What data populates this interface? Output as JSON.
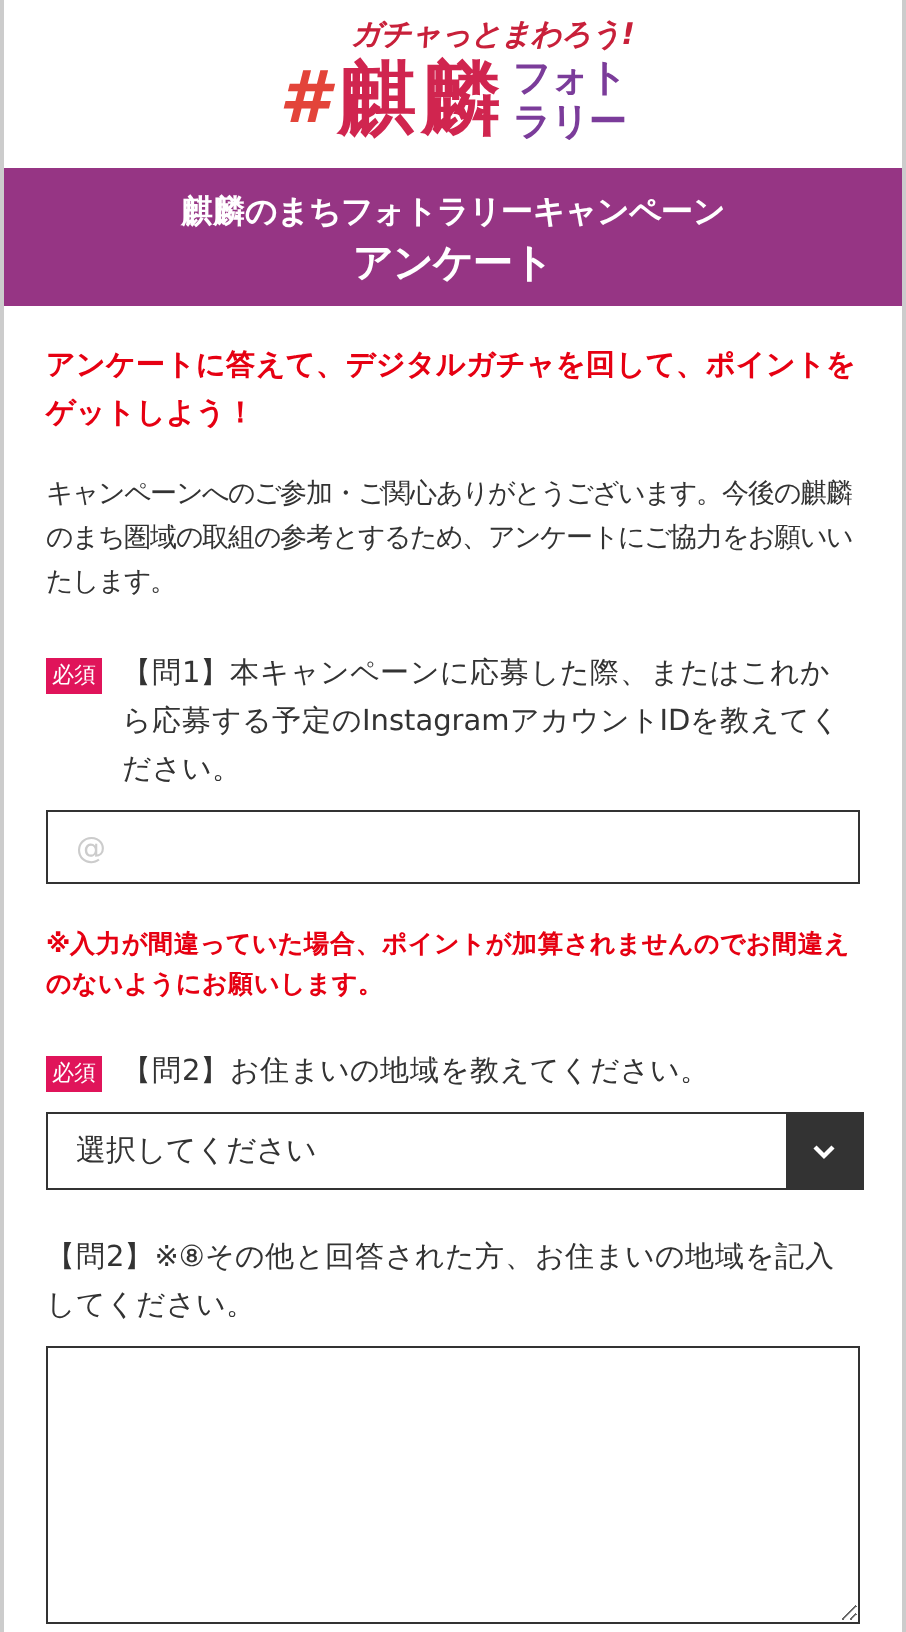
{
  "logo": {
    "tagline": "ガチャっとまわろう!",
    "hashtag": "#",
    "name": "麒麟",
    "photo": "フォト",
    "rally": "ラリー"
  },
  "header": {
    "line1": "麒麟のまちフォトラリーキャンペーン",
    "line2": "アンケート"
  },
  "lead": "アンケートに答えて、デジタルガチャを回して、ポイントをゲットしよう！",
  "intro": "キャンペーンへのご参加・ご関心ありがとうございます。今後の麒麟のまち圏域の取組の参考とするため、アンケートにご協力をお願いいたします。",
  "questions": [
    {
      "kind": "text",
      "required": true,
      "badge": "必須",
      "label": "【問1】本キャンペーンに応募した際、またはこれから応募する予定のInstagramアカウントIDを教えてください。",
      "placeholder": "@",
      "note": "※入力が間違っていた場合、ポイントが加算されませんのでお間違えのないようにお願いします。"
    },
    {
      "kind": "select",
      "required": true,
      "badge": "必須",
      "label": "【問2】お住まいの地域を教えてください。",
      "value": "選択してください"
    },
    {
      "kind": "textarea",
      "required": false,
      "label": "【問2】※⑧その他と回答された方、お住まいの地域を記入してください。"
    }
  ]
}
